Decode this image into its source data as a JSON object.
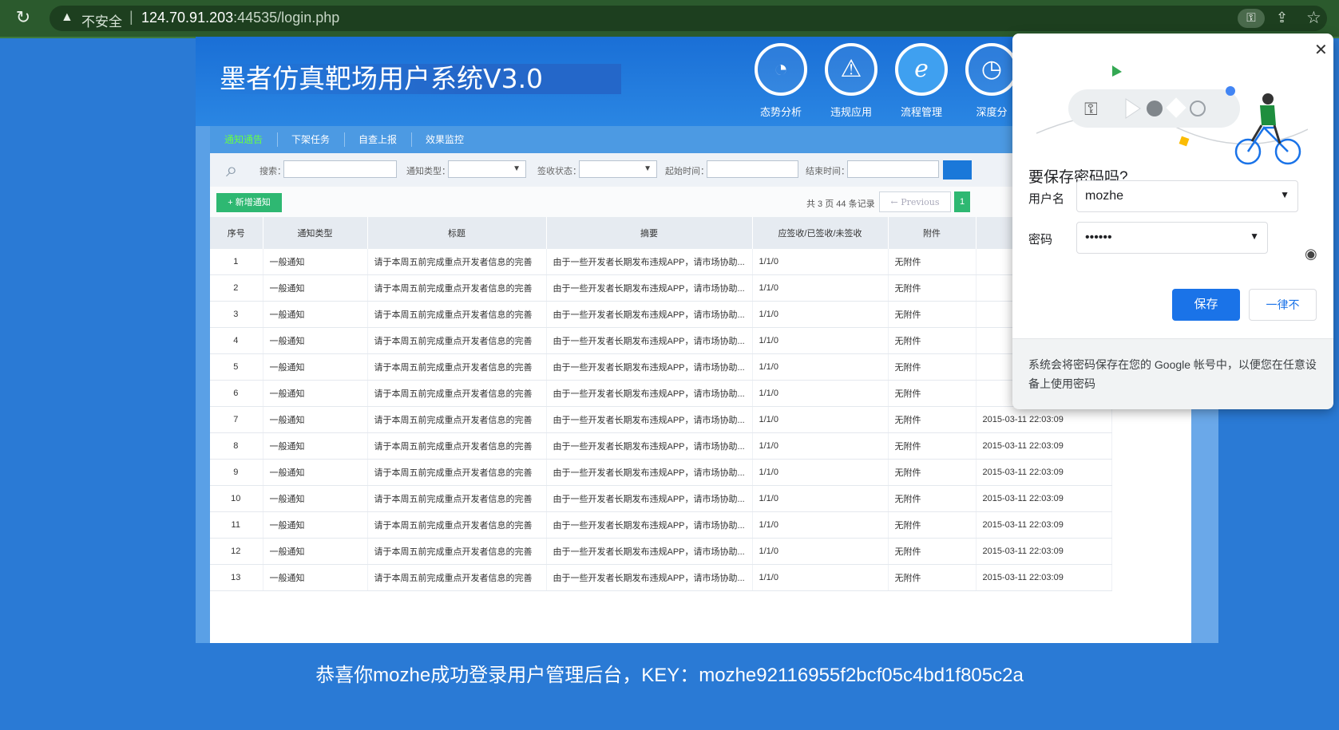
{
  "browser": {
    "insecure_label": "不安全",
    "separator": "|",
    "url_host": "124.70.91.203",
    "url_rest": ":44535/login.php"
  },
  "app": {
    "title": "墨者仿真靶场用户系统V3.0",
    "nav": [
      {
        "label": "态势分析",
        "icon": "pie-chart-icon"
      },
      {
        "label": "违规应用",
        "icon": "warning-icon"
      },
      {
        "label": "流程管理",
        "icon": "ie-browser-icon"
      },
      {
        "label": "深度分",
        "icon": "gauge-icon"
      }
    ],
    "tabs": [
      "通知通告",
      "下架任务",
      "自查上报",
      "效果监控"
    ],
    "filters": {
      "search_label": "搜索：",
      "type_label": "通知类型：",
      "status_label": "签收状态：",
      "start_label": "起始时间：",
      "end_label": "结束时间："
    },
    "add_button": "+ 新增通知",
    "page_info": "共 3 页 44 条记录",
    "prev_button": "← Previous",
    "page_button": "1",
    "columns": [
      "序号",
      "通知类型",
      "标题",
      "摘要",
      "应签收/已签收/未签收",
      "附件",
      ""
    ],
    "rows": [
      [
        "1",
        "一般通知",
        "请于本周五前完成重点开发者信息的完善",
        "由于一些开发者长期发布违规APP，请市场协助...",
        "1/1/0",
        "无附件",
        ""
      ],
      [
        "2",
        "一般通知",
        "请于本周五前完成重点开发者信息的完善",
        "由于一些开发者长期发布违规APP，请市场协助...",
        "1/1/0",
        "无附件",
        ""
      ],
      [
        "3",
        "一般通知",
        "请于本周五前完成重点开发者信息的完善",
        "由于一些开发者长期发布违规APP，请市场协助...",
        "1/1/0",
        "无附件",
        ""
      ],
      [
        "4",
        "一般通知",
        "请于本周五前完成重点开发者信息的完善",
        "由于一些开发者长期发布违规APP，请市场协助...",
        "1/1/0",
        "无附件",
        ""
      ],
      [
        "5",
        "一般通知",
        "请于本周五前完成重点开发者信息的完善",
        "由于一些开发者长期发布违规APP，请市场协助...",
        "1/1/0",
        "无附件",
        ""
      ],
      [
        "6",
        "一般通知",
        "请于本周五前完成重点开发者信息的完善",
        "由于一些开发者长期发布违规APP，请市场协助...",
        "1/1/0",
        "无附件",
        ""
      ],
      [
        "7",
        "一般通知",
        "请于本周五前完成重点开发者信息的完善",
        "由于一些开发者长期发布违规APP，请市场协助...",
        "1/1/0",
        "无附件",
        "2015-03-11 22:03:09"
      ],
      [
        "8",
        "一般通知",
        "请于本周五前完成重点开发者信息的完善",
        "由于一些开发者长期发布违规APP，请市场协助...",
        "1/1/0",
        "无附件",
        "2015-03-11 22:03:09"
      ],
      [
        "9",
        "一般通知",
        "请于本周五前完成重点开发者信息的完善",
        "由于一些开发者长期发布违规APP，请市场协助...",
        "1/1/0",
        "无附件",
        "2015-03-11 22:03:09"
      ],
      [
        "10",
        "一般通知",
        "请于本周五前完成重点开发者信息的完善",
        "由于一些开发者长期发布违规APP，请市场协助...",
        "1/1/0",
        "无附件",
        "2015-03-11 22:03:09"
      ],
      [
        "11",
        "一般通知",
        "请于本周五前完成重点开发者信息的完善",
        "由于一些开发者长期发布违规APP，请市场协助...",
        "1/1/0",
        "无附件",
        "2015-03-11 22:03:09"
      ],
      [
        "12",
        "一般通知",
        "请于本周五前完成重点开发者信息的完善",
        "由于一些开发者长期发布违规APP，请市场协助...",
        "1/1/0",
        "无附件",
        "2015-03-11 22:03:09"
      ],
      [
        "13",
        "一般通知",
        "请于本周五前完成重点开发者信息的完善",
        "由于一些开发者长期发布违规APP，请市场协助...",
        "1/1/0",
        "无附件",
        "2015-03-11 22:03:09"
      ]
    ]
  },
  "congrats": "恭喜你mozhe成功登录用户管理后台，KEY：mozhe92116955f2bcf05c4bd1f805c2a",
  "password_popup": {
    "title": "要保存密码吗?",
    "username_label": "用户名",
    "username_value": "mozhe",
    "password_label": "密码",
    "password_value": "••••••",
    "save_button": "保存",
    "never_button": "一律不",
    "footer": "系统会将密码保存在您的 Google 帐号中，以便您在任意设备上使用密码"
  },
  "colors": {
    "page_bg": "#2a7ad5",
    "browser_bar": "#2b5a2d",
    "accent_blue": "#1a73e8",
    "add_green": "#2eb872",
    "active_tab": "#66ff44"
  }
}
